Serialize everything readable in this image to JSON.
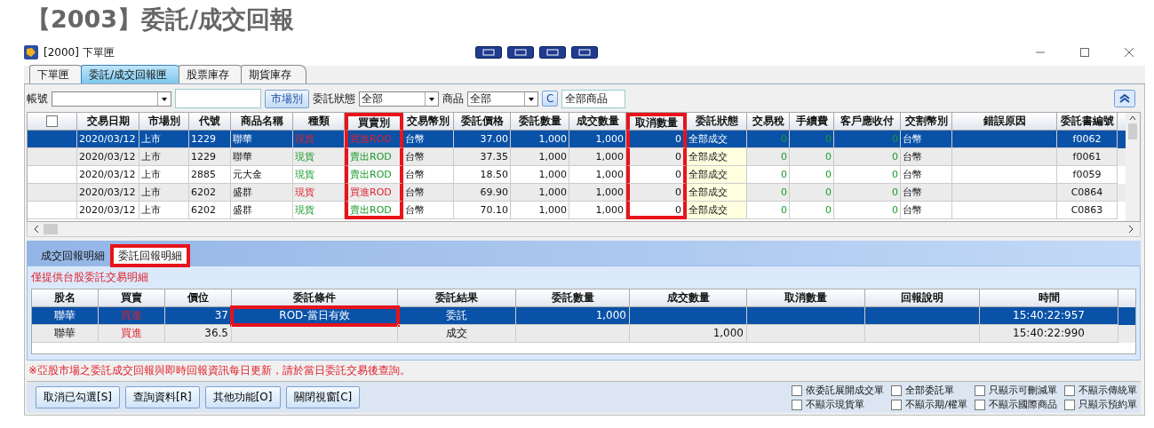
{
  "page_title": "【2003】委託/成交回報",
  "window": {
    "title": "[2000] 下單匣"
  },
  "tabs": [
    {
      "label": "下單匣",
      "selected": false
    },
    {
      "label": "委託/成交回報匣",
      "selected": true
    },
    {
      "label": "股票庫存",
      "selected": false
    },
    {
      "label": "期貨庫存",
      "selected": false
    }
  ],
  "filters": {
    "account_label": "帳號",
    "market_button": "市場別",
    "status_label": "委託狀態",
    "status_value": "全部",
    "product_label": "商品",
    "product_value": "全部",
    "c_button": "C",
    "product_field": "全部商品"
  },
  "orders": {
    "select_all": {
      "checked": false
    },
    "columns": [
      {
        "label": "交易日期",
        "highlighted": false
      },
      {
        "label": "市場別",
        "highlighted": false
      },
      {
        "label": "代號",
        "highlighted": false
      },
      {
        "label": "商品名稱",
        "highlighted": false
      },
      {
        "label": "種類",
        "highlighted": false
      },
      {
        "label": "買賣別",
        "highlighted": true
      },
      {
        "label": "交易幣別",
        "highlighted": false
      },
      {
        "label": "委託價格",
        "highlighted": false
      },
      {
        "label": "委託數量",
        "highlighted": false
      },
      {
        "label": "成交數量",
        "highlighted": false
      },
      {
        "label": "取消數量",
        "highlighted": true
      },
      {
        "label": "委託狀態",
        "highlighted": false
      },
      {
        "label": "交易稅",
        "highlighted": false
      },
      {
        "label": "手續費",
        "highlighted": false
      },
      {
        "label": "客戶應收付",
        "highlighted": false
      },
      {
        "label": "交割幣別",
        "highlighted": false
      },
      {
        "label": "錯誤原因",
        "highlighted": false
      },
      {
        "label": "委託書編號",
        "highlighted": false
      }
    ],
    "rows": [
      {
        "selected": true,
        "kind": "buy",
        "cells": [
          "2020/03/12",
          "上市",
          "1229",
          "聯華",
          "現貨",
          "買進ROD",
          "台幣",
          "37.00",
          "1,000",
          "1,000",
          "0",
          "全部成交",
          "0",
          "0",
          "0",
          "台幣",
          "",
          "f0062"
        ]
      },
      {
        "selected": false,
        "kind": "sell",
        "cells": [
          "2020/03/12",
          "上市",
          "1229",
          "聯華",
          "現貨",
          "賣出ROD",
          "台幣",
          "37.35",
          "1,000",
          "1,000",
          "0",
          "全部成交",
          "0",
          "0",
          "0",
          "台幣",
          "",
          "f0061"
        ]
      },
      {
        "selected": false,
        "kind": "sell",
        "cells": [
          "2020/03/12",
          "上市",
          "2885",
          "元大金",
          "現貨",
          "賣出ROD",
          "台幣",
          "18.50",
          "1,000",
          "1,000",
          "0",
          "全部成交",
          "0",
          "0",
          "0",
          "台幣",
          "",
          "f0059"
        ]
      },
      {
        "selected": false,
        "kind": "buy",
        "cells": [
          "2020/03/12",
          "上市",
          "6202",
          "盛群",
          "現貨",
          "買進ROD",
          "台幣",
          "69.90",
          "1,000",
          "1,000",
          "0",
          "全部成交",
          "0",
          "0",
          "0",
          "台幣",
          "",
          "C0864"
        ]
      },
      {
        "selected": false,
        "kind": "sell",
        "cells": [
          "2020/03/12",
          "上市",
          "6202",
          "盛群",
          "現貨",
          "賣出ROD",
          "台幣",
          "70.10",
          "1,000",
          "1,000",
          "0",
          "全部成交",
          "0",
          "0",
          "0",
          "台幣",
          "",
          "C0863"
        ]
      }
    ]
  },
  "detail_tabs": [
    {
      "label": "成交回報明細",
      "selected": false,
      "highlighted": false
    },
    {
      "label": "委託回報明細",
      "selected": true,
      "highlighted": true
    }
  ],
  "detail_note": "僅提供台股委託交易明細",
  "details": {
    "columns": [
      "股名",
      "買賣",
      "價位",
      "委託條件",
      "委託結果",
      "委託數量",
      "成交數量",
      "取消數量",
      "回報說明",
      "時間"
    ],
    "rows": [
      {
        "selected": true,
        "cells": [
          {
            "text": "聯華"
          },
          {
            "text": "買進"
          },
          {
            "text": "37"
          },
          {
            "text": "ROD-當日有效",
            "highlighted": true
          },
          {
            "text": "委託"
          },
          {
            "text": "1,000"
          },
          {},
          {},
          {},
          {
            "text": "15:40:22:957"
          }
        ]
      },
      {
        "selected": false,
        "cells": [
          {
            "text": "聯華"
          },
          {
            "text": "買進"
          },
          {
            "text": "36.5"
          },
          {},
          {
            "text": "成交"
          },
          {},
          {
            "text": "1,000"
          },
          {},
          {},
          {
            "text": "15:40:22:990"
          }
        ]
      }
    ]
  },
  "footer_note": "※亞股市場之委託成交回報與即時回報資訊每日更新，請於當日委託交易後查詢。",
  "buttons": [
    "取消已勾選[S]",
    "查詢資料[R]",
    "其他功能[O]",
    "關閉視窗[C]"
  ],
  "options": [
    {
      "label": "依委託展開成交單",
      "checked": false
    },
    {
      "label": "全部委託單",
      "checked": false
    },
    {
      "label": "只顯示可刪減單",
      "checked": false
    },
    {
      "label": "不顯示傳統單",
      "checked": false
    },
    {
      "label": "不顯示現貨單",
      "checked": false
    },
    {
      "label": "不顯示期/權單",
      "checked": false
    },
    {
      "label": "不顯示國際商品",
      "checked": false
    },
    {
      "label": "只顯示預約單",
      "checked": false
    }
  ]
}
